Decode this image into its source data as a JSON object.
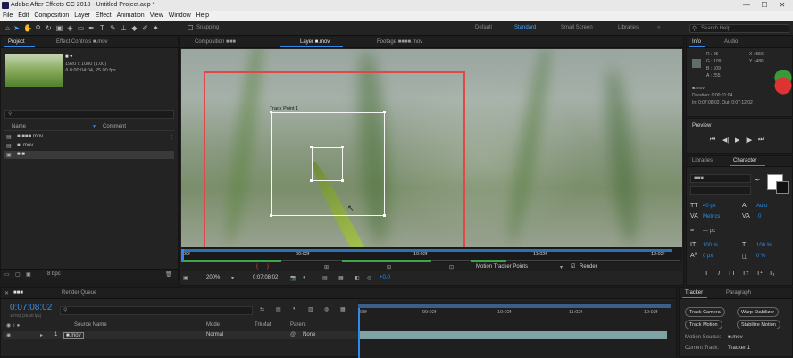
{
  "window": {
    "title": "Adobe After Effects CC 2018 - Untitled Project.aep *",
    "minimize": "—",
    "maximize": "☐",
    "close": "✕"
  },
  "menu": [
    "File",
    "Edit",
    "Composition",
    "Layer",
    "Effect",
    "Animation",
    "View",
    "Window",
    "Help"
  ],
  "toolbar": {
    "snapping": "Snapping",
    "workspaces": [
      "Default",
      "Standard",
      "Small Screen",
      "Libraries"
    ],
    "search_placeholder": "Search Help"
  },
  "project_panel": {
    "tabs": [
      "Project",
      "Effect Controls ■.mov"
    ],
    "item_name": "■ ▾",
    "item_line1": "1920 x 1080 (1.00)",
    "item_line2": "Δ 0:00:04:04, 25.00 fps",
    "search_placeholder": "",
    "col_name": "Name",
    "col_comment": "Comment",
    "items": [
      {
        "name": "■ ■■■.mov"
      },
      {
        "name": "■ .mov"
      },
      {
        "name": "■ ■"
      }
    ],
    "bpc": "8 bpc"
  },
  "viewer": {
    "tabs": [
      "Composition ■■■",
      "Layer ■.mov",
      "Footage ■■■■.mov"
    ],
    "track_point_label": "Track Point 1",
    "ruler_ticks": [
      "00f",
      "09:02f",
      "10:02f",
      "11:02f",
      "12:02f"
    ],
    "view_select": "Motion Tracker Points",
    "render_label": "Render",
    "zoom": "200%",
    "timecode": "0:07:08:02",
    "exposure": "+0.0"
  },
  "info_panel": {
    "tabs": [
      "Info",
      "Audio"
    ],
    "r": "R : 95",
    "g": "G : 109",
    "b": "B : 109",
    "a": "A : 255",
    "x": "X : 556",
    "y": "Y : 486",
    "file": "■.mov",
    "duration": "Duration: 0:00:01:04",
    "in_out": "In: 0:07:08:02, Out: 0:07:12:02"
  },
  "preview_panel": {
    "title": "Preview",
    "controls": [
      "⏮",
      "◀|",
      "▶",
      "|▶",
      "⏭"
    ]
  },
  "character_panel": {
    "tabs": [
      "Libraries",
      "Character"
    ],
    "font": "■■■",
    "size": "40 px",
    "leading": "Auto",
    "tracking": "0",
    "kern": "Metrics",
    "stroke": "— px",
    "scale_v": "100 %",
    "scale_h": "100 %",
    "baseline": "0 px",
    "tsume": "0 %",
    "styles": [
      "T",
      "T",
      "TT",
      "Tт",
      "T¹",
      "T₁"
    ]
  },
  "timeline": {
    "tabs": [
      "■■■",
      "Render Queue"
    ],
    "timecode": "0:07:08:02",
    "timecode_sub": "10702 (25.00 fps)",
    "search_placeholder": "",
    "columns": {
      "source": "Source Name",
      "mode": "Mode",
      "trkmat": "TrkMat",
      "parent": "Parent"
    },
    "layer": {
      "index": "1",
      "name": "■.mov",
      "mode": "Normal",
      "parent": "None"
    },
    "ticks": [
      "08f",
      "09:02f",
      "10:02f",
      "11:02f",
      "12:02f"
    ]
  },
  "tracker_panel": {
    "tabs": [
      "Tracker",
      "Paragraph"
    ],
    "buttons": [
      "Track Camera",
      "Warp Stabilizer",
      "Track Motion",
      "Stabilize Motion"
    ],
    "motion_source_label": "Motion Source:",
    "motion_source": "■.mov",
    "current_track_label": "Current Track:",
    "current_track": "Tracker 1"
  },
  "colors": {
    "accent": "#2d8ceb",
    "timecode": "#3a8ee6",
    "track_red": "#e04848",
    "bg": "#1c1c1c"
  }
}
